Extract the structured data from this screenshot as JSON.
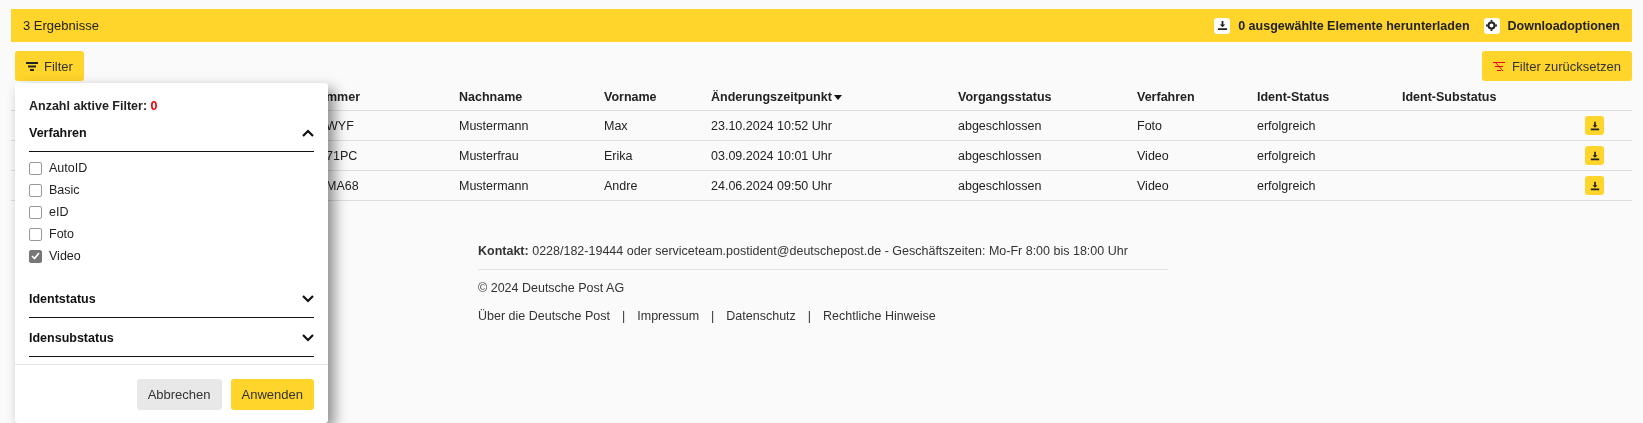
{
  "results_bar": {
    "count_label": "3 Ergebnisse",
    "actions": [
      {
        "kind": "download",
        "label": "0 ausgewählte Elemente herunterladen"
      },
      {
        "kind": "settings",
        "label": "Downloadoptionen"
      }
    ]
  },
  "filter_button": {
    "label": "Filter"
  },
  "reset_filter_button": {
    "label": "Filter zurücksetzen"
  },
  "table": {
    "columns": [
      {
        "label": "mmer",
        "sorted": false
      },
      {
        "label": "Nachname",
        "sorted": false
      },
      {
        "label": "Vorname",
        "sorted": false
      },
      {
        "label": "Änderungszeitpunkt",
        "sorted": true
      },
      {
        "label": "Vorgangsstatus",
        "sorted": false
      },
      {
        "label": "Verfahren",
        "sorted": false
      },
      {
        "label": "Ident-Status",
        "sorted": false
      },
      {
        "label": "Ident-Substatus",
        "sorted": false
      }
    ],
    "rows": [
      {
        "cells": [
          "WYF",
          "Mustermann",
          "Max",
          "23.10.2024 10:52 Uhr",
          "abgeschlossen",
          "Foto",
          "erfolgreich",
          ""
        ]
      },
      {
        "cells": [
          "71PC",
          "Musterfrau",
          "Erika",
          "03.09.2024 10:01 Uhr",
          "abgeschlossen",
          "Video",
          "erfolgreich",
          ""
        ]
      },
      {
        "cells": [
          "MA68",
          "Mustermann",
          "Andre",
          "24.06.2024 09:50 Uhr",
          "abgeschlossen",
          "Video",
          "erfolgreich",
          ""
        ]
      }
    ]
  },
  "filter_panel": {
    "active_label": "Anzahl aktive Filter:",
    "active_count": "0",
    "sections": [
      {
        "title": "Verfahren",
        "expanded": true,
        "options": [
          {
            "label": "AutoID",
            "checked": false
          },
          {
            "label": "Basic",
            "checked": false
          },
          {
            "label": "eID",
            "checked": false
          },
          {
            "label": "Foto",
            "checked": false
          },
          {
            "label": "Video",
            "checked": true
          }
        ]
      },
      {
        "title": "Identstatus",
        "expanded": false
      },
      {
        "title": "Idensubstatus",
        "expanded": false
      }
    ],
    "buttons": [
      {
        "kind": "secondary",
        "label": "Abbrechen"
      },
      {
        "kind": "primary",
        "label": "Anwenden"
      }
    ]
  },
  "footer": {
    "contact": "**Kontakt:** 0228/182-19444 oder serviceteam.postident@deutschepost.de - Geschäftszeiten: Mo-Fr 8:00 bis 18:00 Uhr",
    "copyright": "© 2024 Deutsche Post AG",
    "separator": "|",
    "links": [
      "Über die Deutsche Post",
      "Impressum",
      "Datenschutz",
      "Rechtliche Hinweise"
    ]
  }
}
